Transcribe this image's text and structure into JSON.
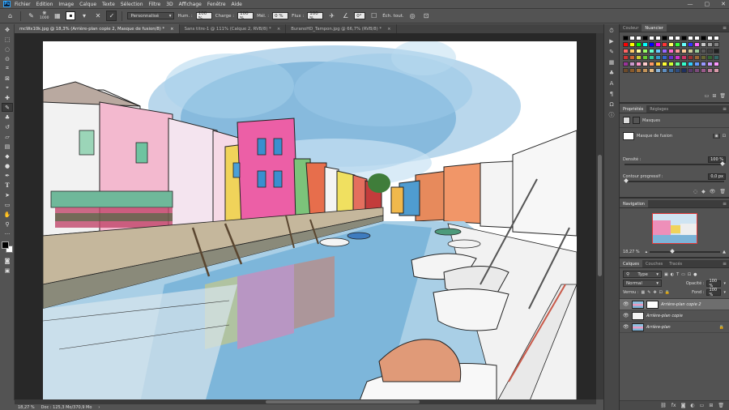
{
  "menubar": {
    "items": [
      "Fichier",
      "Edition",
      "Image",
      "Calque",
      "Texte",
      "Sélection",
      "Filtre",
      "3D",
      "Affichage",
      "Fenêtre",
      "Aide"
    ],
    "window_controls": [
      "—",
      "▢",
      "✕"
    ]
  },
  "optionsbar": {
    "brush_size": "1000",
    "mode": "Personnalisé",
    "hum_label": "Hum. :",
    "hum_value": "100 %",
    "charge_label": "Charge :",
    "charge_value": "100 %",
    "mel_label": "Mél. :",
    "mel_value": "0 %",
    "flux_label": "Flux :",
    "flux_value": "100 %",
    "angle_value": "0°",
    "sample_all": "Éch. tout."
  },
  "tabs": [
    {
      "label": "mcWx10k.jpg @ 18,3% (Arrière-plan copie 2, Masque de fusion/8) *",
      "active": true
    },
    {
      "label": "Sans titre-1 @ 111% (Calque 2, RVB/8) *",
      "active": false
    },
    {
      "label": "BuranoHD_Tampon.jpg @ 66,7% (RVB/8) *",
      "active": false
    }
  ],
  "status": {
    "zoom": "18,27 %",
    "doc": "Doc : 125,3 Mo/370,9 Mo"
  },
  "swatches_panel": {
    "tabs": [
      "Couleur",
      "Nuancier"
    ],
    "active_tab": 1,
    "rows": [
      [
        "#000000",
        "#ffffff",
        "#ffffff",
        "#000000",
        "#ffffff",
        "#ffffff",
        "#000000",
        "#ffffff",
        "#ffffff",
        "#000000",
        "#ffffff",
        "#ffffff",
        "#000000",
        "#ffffff",
        "#ffffff"
      ],
      [
        "#ff0000",
        "#ffff00",
        "#00ff00",
        "#00ffff",
        "#0000ff",
        "#ff00ff",
        "#ff3333",
        "#ffff66",
        "#33ff33",
        "#66ffff",
        "#3333ff",
        "#ff66ff",
        "#c8c8c8",
        "#a0a0a0",
        "#808080"
      ],
      [
        "#ff6666",
        "#ffcc66",
        "#ffff99",
        "#99ff66",
        "#66ffcc",
        "#66ccff",
        "#9966ff",
        "#ff66cc",
        "#ff9999",
        "#ffcc99",
        "#cccc99",
        "#99cc99",
        "#5a5a5a",
        "#404040",
        "#202020"
      ],
      [
        "#cc3333",
        "#cc6633",
        "#cccc33",
        "#66cc33",
        "#33cc99",
        "#3399cc",
        "#3366cc",
        "#6633cc",
        "#cc33cc",
        "#cc3366",
        "#993333",
        "#996633",
        "#666633",
        "#336633",
        "#336666"
      ],
      [
        "#993399",
        "#cc99cc",
        "#ff99cc",
        "#ffcccc",
        "#ff9966",
        "#ffcc33",
        "#ffff33",
        "#ccff33",
        "#66ff99",
        "#33ffcc",
        "#33ccff",
        "#6699ff",
        "#9999ff",
        "#cc99ff",
        "#ff99ff"
      ],
      [
        "#6b4a2a",
        "#8a5a2a",
        "#a8743a",
        "#c4945a",
        "#e0b883",
        "#8ab4d8",
        "#5e8ec0",
        "#3e6ea0",
        "#2e4e80",
        "#1e3060",
        "#5a3a6a",
        "#7a4a7a",
        "#9a5a8a",
        "#ba7a9a",
        "#da9aaa"
      ]
    ]
  },
  "properties_panel": {
    "tabs": [
      "Propriétés",
      "Réglages"
    ],
    "section_label": "Masques",
    "mask_label": "Masque de fusion",
    "density_label": "Densité :",
    "density_value": "100 %",
    "feather_label": "Contour progressif :",
    "feather_value": "0,0 px"
  },
  "navigator_panel": {
    "title": "Navigation",
    "zoom": "18,27 %"
  },
  "layers_panel": {
    "tabs": [
      "Calques",
      "Couches",
      "Tracés"
    ],
    "kind_filter": "Type",
    "blend_mode": "Normal",
    "opacity_label": "Opacité :",
    "opacity_value": "100 %",
    "lock_label": "Verrou :",
    "fill_label": "Fond :",
    "fill_value": "100 %",
    "layers": [
      {
        "name": "Arrière-plan copie 2",
        "selected": true,
        "has_mask": true
      },
      {
        "name": "Arrière-plan copie",
        "selected": false,
        "has_mask": false
      },
      {
        "name": "Arrière-plan",
        "selected": false,
        "has_mask": false,
        "locked": true
      }
    ]
  }
}
